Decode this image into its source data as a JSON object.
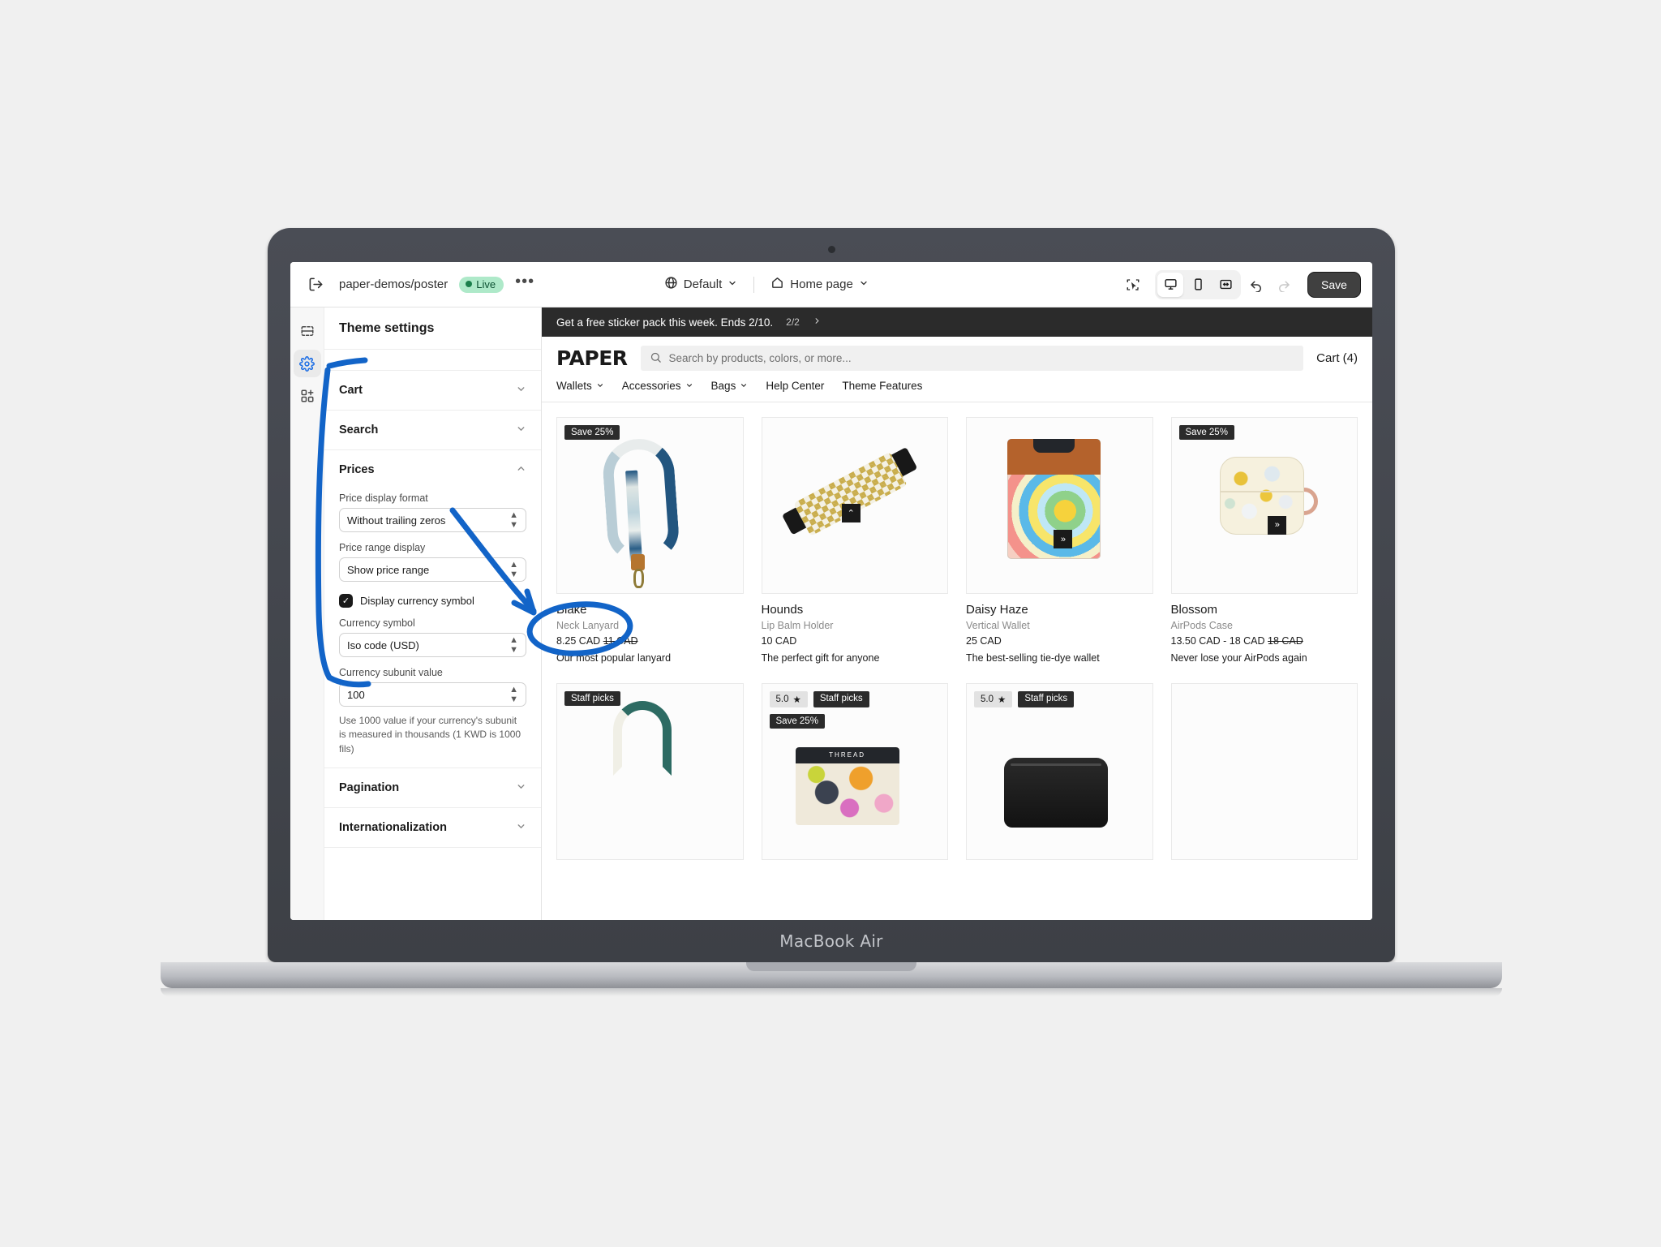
{
  "device": {
    "label": "MacBook Air"
  },
  "topbar": {
    "exit_icon": "exit-icon",
    "store_name": "paper-demos/poster",
    "live_label": "Live",
    "more_label": "•••",
    "locale": {
      "icon": "globe-icon",
      "label": "Default"
    },
    "page": {
      "icon": "home-icon",
      "label": "Home page"
    },
    "tools": {
      "inspector_icon": "selection-cursor-icon",
      "desktop_icon": "desktop-icon",
      "mobile_icon": "mobile-icon",
      "fullwidth_icon": "full-width-icon",
      "undo_icon": "undo-icon",
      "redo_icon": "redo-icon"
    },
    "save_label": "Save"
  },
  "rail": {
    "items": [
      {
        "name": "sections-icon",
        "active": false
      },
      {
        "name": "gear-icon",
        "active": true
      },
      {
        "name": "apps-icon",
        "active": false
      }
    ]
  },
  "panel": {
    "title": "Theme settings",
    "sections": [
      {
        "label": "Cart",
        "expanded": false
      },
      {
        "label": "Search",
        "expanded": false
      },
      {
        "label": "Prices",
        "expanded": true
      },
      {
        "label": "Pagination",
        "expanded": false
      },
      {
        "label": "Internationalization",
        "expanded": false
      }
    ],
    "prices": {
      "price_display_format": {
        "label": "Price display format",
        "value": "Without trailing zeros"
      },
      "price_range_display": {
        "label": "Price range display",
        "value": "Show price range"
      },
      "display_currency_symbol": {
        "label": "Display currency symbol",
        "checked": true
      },
      "currency_symbol": {
        "label": "Currency symbol",
        "value": "Iso code (USD)"
      },
      "currency_subunit_value": {
        "label": "Currency subunit value",
        "value": "100"
      },
      "help_text": "Use 1000 value if your currency's subunit is measured in thousands (1 KWD is 1000 fils)"
    }
  },
  "preview": {
    "announcement": {
      "text": "Get a free sticker pack this week. Ends 2/10.",
      "count": "2/2",
      "next_icon": "chevron-right-icon"
    },
    "header": {
      "logo": "PAPER",
      "search_placeholder": "Search by products, colors, or more...",
      "search_icon": "search-icon",
      "cart_label": "Cart (4)"
    },
    "nav": [
      {
        "label": "Wallets",
        "has_menu": true
      },
      {
        "label": "Accessories",
        "has_menu": true
      },
      {
        "label": "Bags",
        "has_menu": true
      },
      {
        "label": "Help Center",
        "has_menu": false
      },
      {
        "label": "Theme Features",
        "has_menu": false
      }
    ],
    "products": [
      {
        "title": "Blake",
        "subtitle": "Neck Lanyard",
        "price": "8.25 CAD",
        "compare_price": "11 CAD",
        "description": "Our most popular lanyard",
        "badges": [
          "Save 25%"
        ],
        "rating": null,
        "art": "lanyard"
      },
      {
        "title": "Hounds",
        "subtitle": "Lip Balm Holder",
        "price": "10 CAD",
        "compare_price": "",
        "description": "The perfect gift for anyone",
        "badges": [],
        "rating": null,
        "art": "lipbalm"
      },
      {
        "title": "Daisy Haze",
        "subtitle": "Vertical Wallet",
        "price": "25 CAD",
        "compare_price": "",
        "description": "The best-selling tie-dye wallet",
        "badges": [],
        "rating": null,
        "art": "wallet"
      },
      {
        "title": "Blossom",
        "subtitle": "AirPods Case",
        "price": "13.50 CAD  - 18 CAD",
        "compare_price": "18 CAD",
        "description": "Never lose your AirPods again",
        "badges": [
          "Save 25%"
        ],
        "rating": null,
        "art": "airpods"
      }
    ],
    "products_row2": [
      {
        "badges": [
          "Staff picks"
        ],
        "rating": null,
        "second_badge": "",
        "art": "tote"
      },
      {
        "badges": [
          "Staff picks"
        ],
        "rating": "5.0",
        "second_badge": "Save 25%",
        "art": "floral"
      },
      {
        "badges": [
          "Staff picks"
        ],
        "rating": "5.0",
        "second_badge": "",
        "art": "blackpouch"
      },
      {
        "badges": [],
        "rating": null,
        "second_badge": "",
        "art": ""
      }
    ]
  },
  "colors": {
    "annotation": "#1264c8",
    "accent": "#1f6fe5",
    "live_bg": "#aee9c9",
    "save_bg": "#404040",
    "badge_bg": "#2b2b2b"
  }
}
